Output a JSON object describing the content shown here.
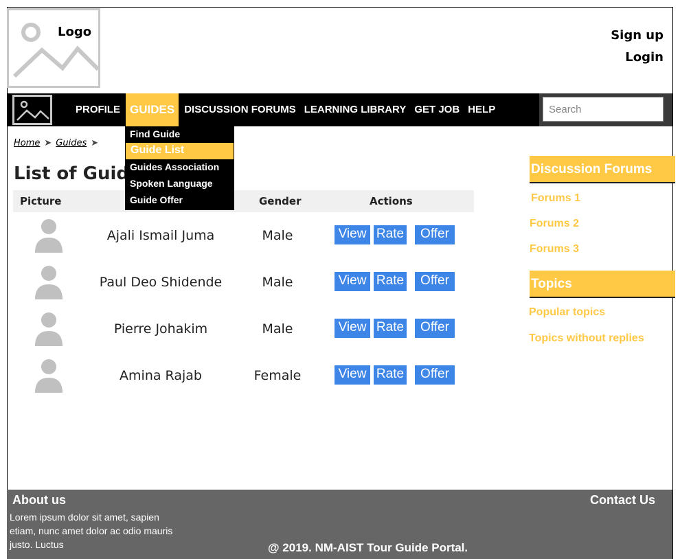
{
  "header": {
    "logo_text": "Logo",
    "signup": "Sign up",
    "login": "Login"
  },
  "nav": {
    "items": [
      "PROFILE",
      "GUIDES",
      "DISCUSSION FORUMS",
      "LEARNING LIBRARY",
      "GET JOB",
      "HELP"
    ],
    "active_index": 1,
    "search_placeholder": "Search"
  },
  "dropdown": {
    "items": [
      "Find Guide",
      "Guide List",
      "Guides Association",
      "Spoken Language",
      "Guide Offer"
    ],
    "active_index": 1
  },
  "breadcrumb": {
    "home": "Home",
    "guides": "Guides"
  },
  "page": {
    "title": "List of Guides"
  },
  "table": {
    "headers": {
      "picture": "Picture",
      "gender": "Gender",
      "actions": "Actions"
    },
    "rows": [
      {
        "name": "Ajali Ismail Juma",
        "gender": "Male"
      },
      {
        "name": "Paul Deo Shidende",
        "gender": "Male"
      },
      {
        "name": "Pierre Johakim",
        "gender": "Male"
      },
      {
        "name": "Amina Rajab",
        "gender": "Female"
      }
    ],
    "actions": {
      "view": "View",
      "rate": "Rate",
      "offer": "Offer"
    }
  },
  "sidebar": {
    "forums_title": "Discussion Forums",
    "forums": [
      "Forums 1",
      "Forums 2",
      "Forums 3"
    ],
    "topics_title": "Topics",
    "topics": [
      "Popular topics",
      "Topics without replies"
    ]
  },
  "footer": {
    "about_title": "About us",
    "about_text": "Lorem ipsum dolor sit amet, sapien etiam, nunc amet dolor ac odio mauris justo. Luctus",
    "contact": "Contact Us",
    "copyright": "@ 2019. NM-AIST Tour Guide Portal."
  },
  "colors": {
    "accent": "#ffc845",
    "button": "#3d85e6",
    "navbar": "#000000",
    "footer": "#666666"
  }
}
